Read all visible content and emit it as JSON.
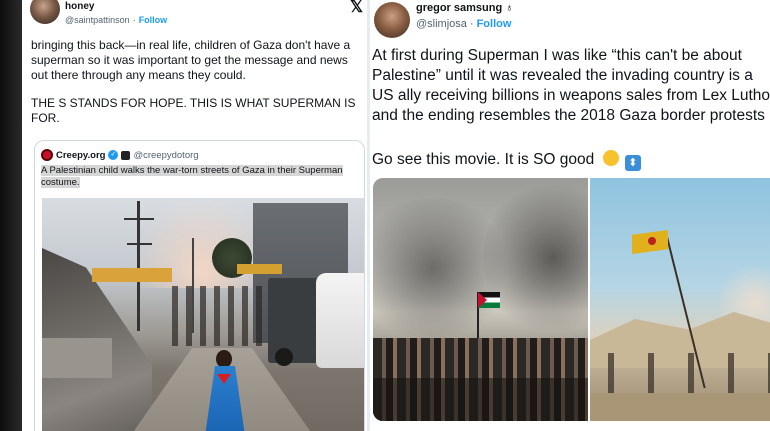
{
  "left_tweet": {
    "name": "honey",
    "handle": "@saintpattinson",
    "follow": "Follow",
    "x_logo": "𝕏",
    "paragraph1": "bringing this back—in real life, children of Gaza don't have a superman so it was important to get the message and news out there through any means they could.",
    "paragraph2": "THE S STANDS FOR HOPE. THIS IS WHAT SUPERMAN IS FOR.",
    "quote": {
      "name": "Creepy.org",
      "handle": "@creepydotorg",
      "text": "A Palestinian child walks the war-torn streets of Gaza in their Superman costume."
    }
  },
  "right_tweet": {
    "name": "gregor samsung",
    "name_emoji": "♁",
    "handle": "@slimjosa",
    "follow": "Follow",
    "line1": "At first during Superman I was like “this can't be about",
    "line2": "Palestine” until it was revealed the invading country is a",
    "line3": "US ally receiving billions in weapons sales from Lex Luthor",
    "line4": "and the ending resembles the 2018 Gaza border protests",
    "line5": "Go see this movie. It is SO good",
    "emoji_arrow": "⬍"
  },
  "colors": {
    "link_blue": "#1d9bf0",
    "text_dark": "#0f1419",
    "muted": "#536471"
  },
  "icons": [
    "x-logo-icon",
    "verified-badge-icon",
    "smile-emoji-icon",
    "up-down-arrow-emoji-icon"
  ]
}
